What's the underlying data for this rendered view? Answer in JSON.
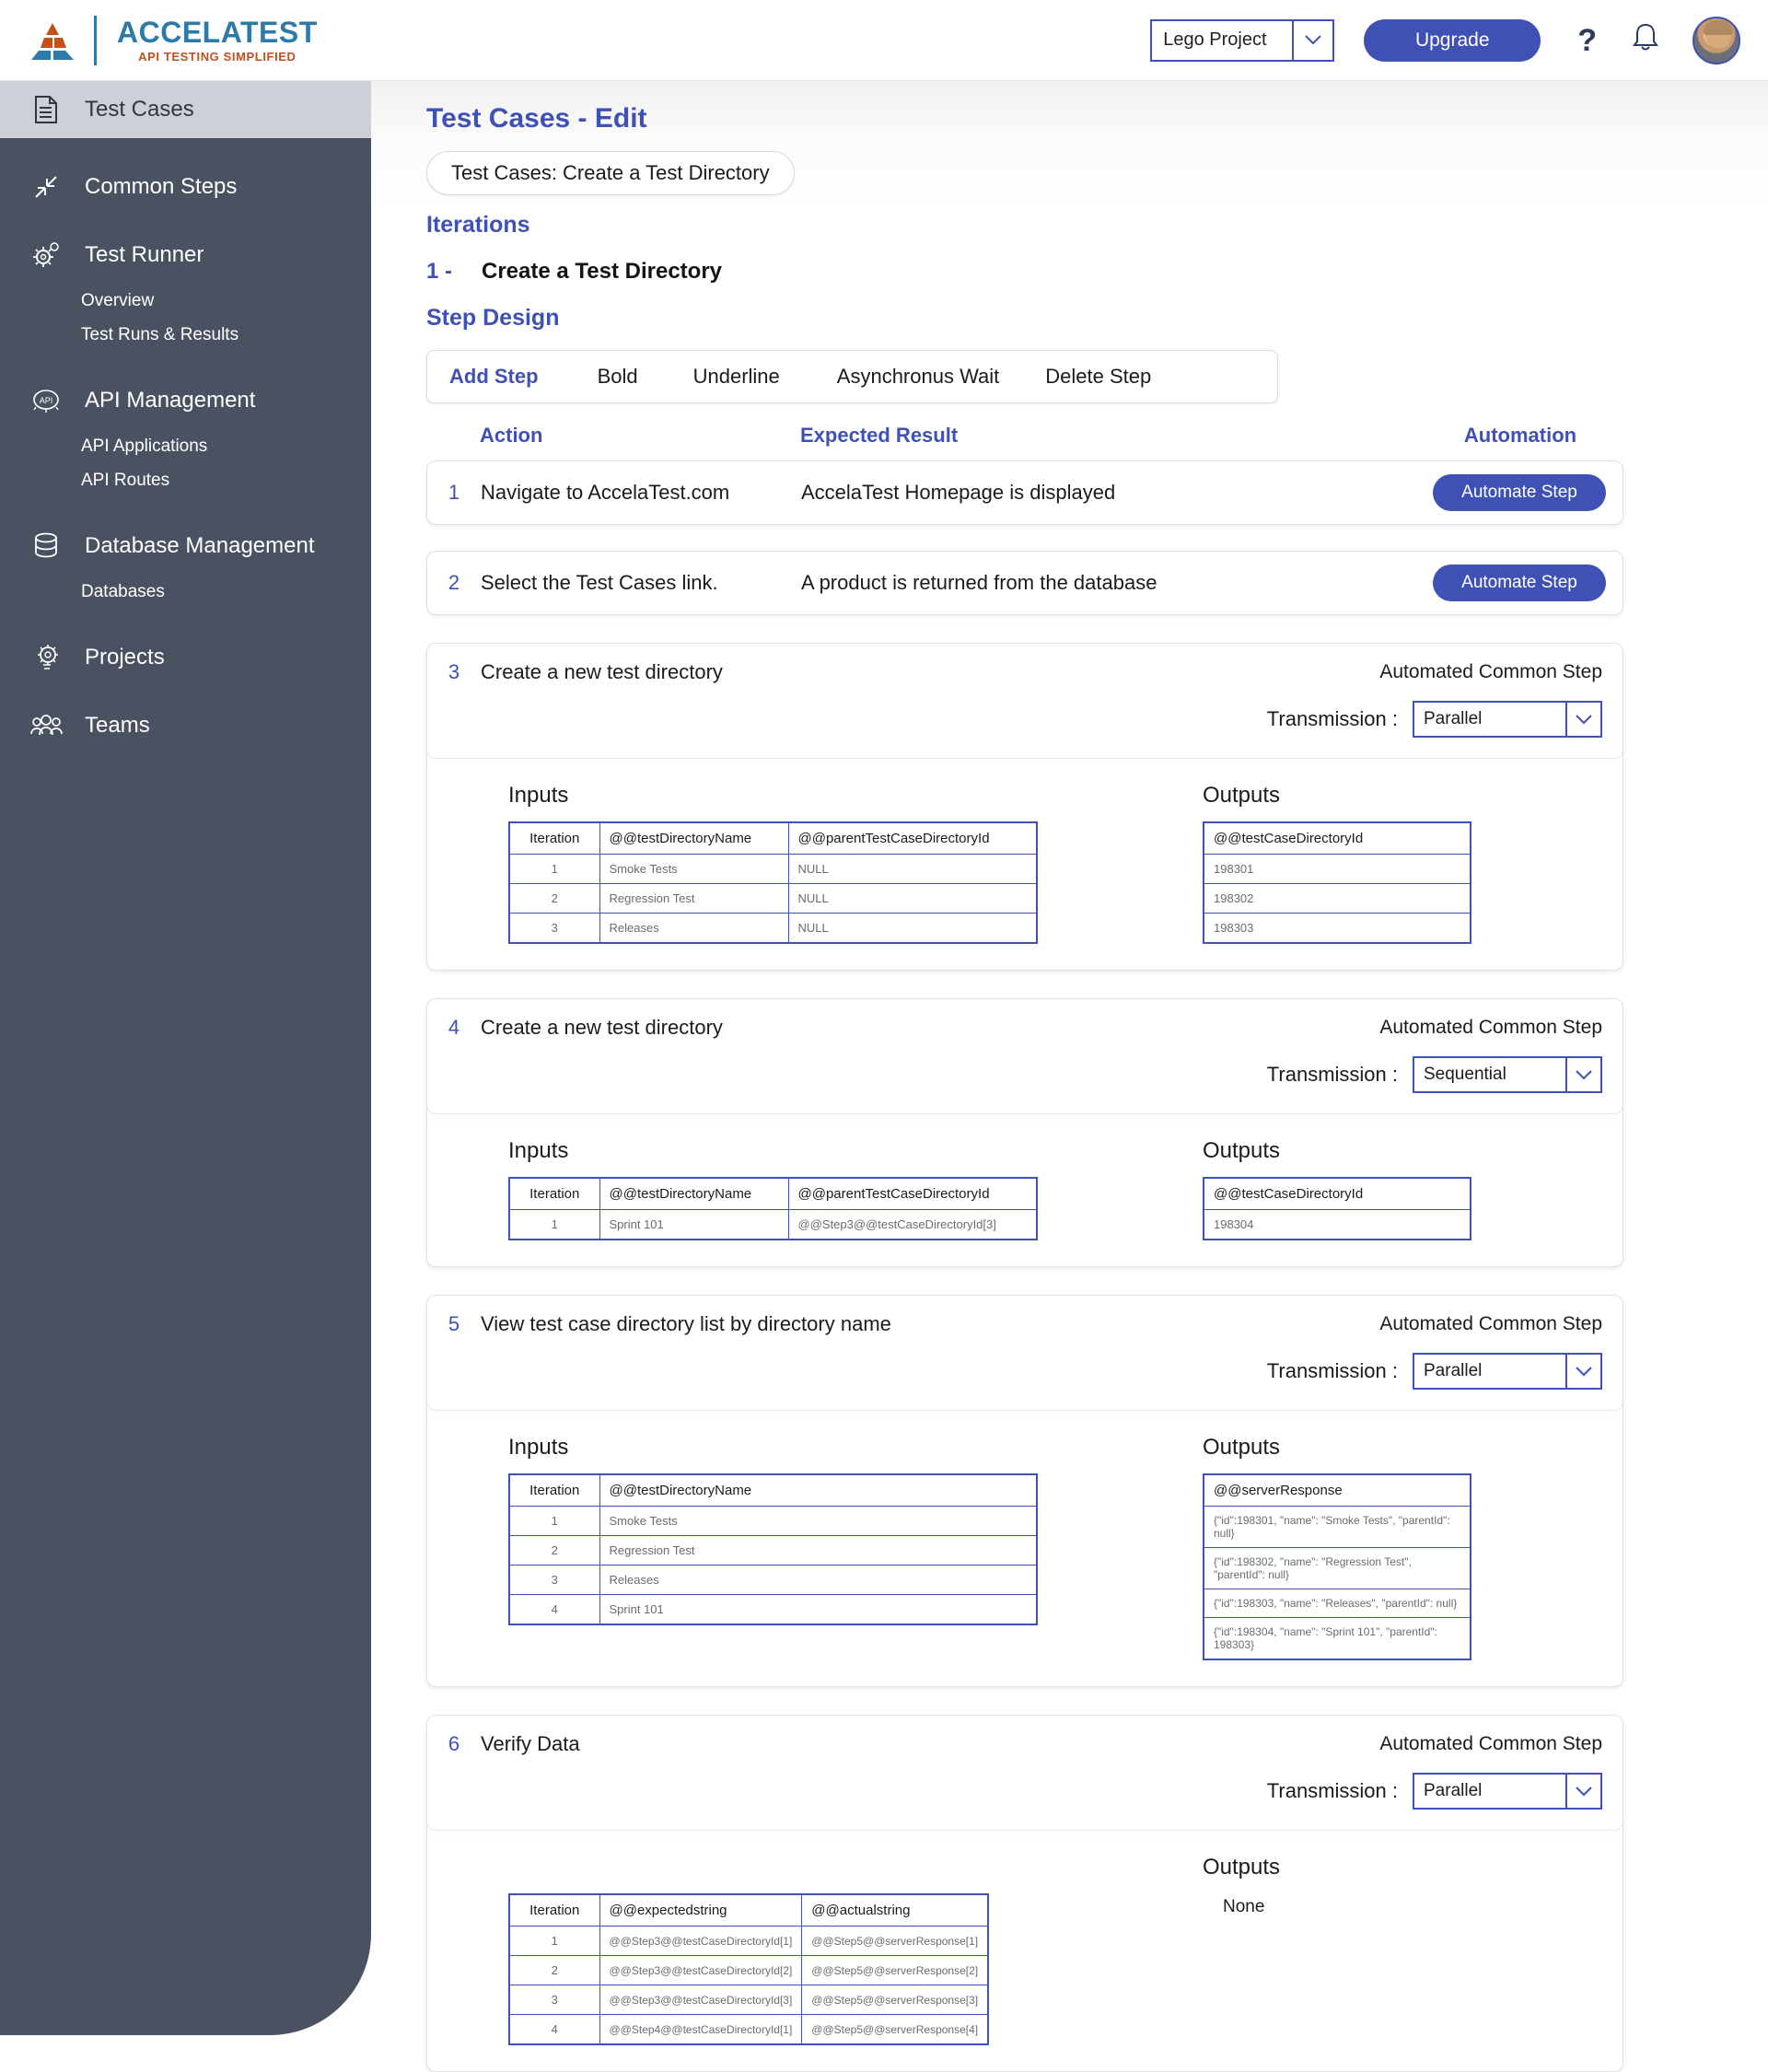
{
  "header": {
    "logo_title_a": "ACCELA",
    "logo_title_b": "TEST",
    "logo_subtitle": "API TESTING SIMPLIFIED",
    "project_select_value": "Lego Project",
    "upgrade_label": "Upgrade",
    "help_label": "?",
    "accent_color": "#3f51b5",
    "logo_blue": "#2e7aa8",
    "logo_orange": "#c24f1c"
  },
  "sidebar": {
    "bg_color": "#4a5261",
    "items": [
      {
        "label": "Test Cases",
        "icon": "document-icon",
        "active": true
      },
      {
        "label": "Common Steps",
        "icon": "arrows-collapse-icon",
        "active": false
      },
      {
        "label": "Test Runner",
        "icon": "gear-icon",
        "active": false
      },
      {
        "label": "API Management",
        "icon": "api-gear-icon",
        "active": false
      },
      {
        "label": "Database Management",
        "icon": "database-icon",
        "active": false
      },
      {
        "label": "Projects",
        "icon": "lightbulb-gear-icon",
        "active": false
      },
      {
        "label": "Teams",
        "icon": "people-icon",
        "active": false
      }
    ],
    "test_runner_sub": [
      "Overview",
      "Test Runs & Results"
    ],
    "api_sub": [
      "API Applications",
      "API Routes"
    ],
    "db_sub": [
      "Databases"
    ]
  },
  "main": {
    "page_title": "Test Cases - Edit",
    "testcase_pill": "Test Cases: Create a Test Directory",
    "iterations_heading": "Iterations",
    "iteration_number": "1 -",
    "iteration_name": "Create a Test Directory",
    "step_design_heading": "Step Design",
    "toolbar": {
      "add_step": "Add Step",
      "bold": "Bold",
      "underline": "Underline",
      "async_wait": "Asynchronus Wait",
      "delete_step": "Delete Step"
    },
    "columns": {
      "action": "Action",
      "expected_result": "Expected Result",
      "automation": "Automation"
    },
    "automate_label": "Automate Step",
    "common_step_badge": "Automated Common Step",
    "transmission_label": "Transmission :",
    "inputs_label": "Inputs",
    "outputs_label": "Outputs",
    "none_label": "None"
  },
  "steps": [
    {
      "number": "1",
      "action": "Navigate to AccelaTest.com",
      "expected": "AccelaTest Homepage is displayed",
      "type": "simple"
    },
    {
      "number": "2",
      "action": "Select the Test Cases link.",
      "expected": "A product is returned from the database",
      "type": "simple"
    },
    {
      "number": "3",
      "action": "Create a new test directory",
      "type": "common",
      "transmission": "Parallel",
      "inputs": {
        "headers": [
          "Iteration",
          "@@testDirectoryName",
          "@@parentTestCaseDirectoryId"
        ],
        "rows": [
          [
            "1",
            "Smoke Tests",
            "NULL"
          ],
          [
            "2",
            "Regression Test",
            "NULL"
          ],
          [
            "3",
            "Releases",
            "NULL"
          ]
        ]
      },
      "outputs": {
        "headers": [
          "@@testCaseDirectoryId"
        ],
        "rows": [
          [
            "198301"
          ],
          [
            "198302"
          ],
          [
            "198303"
          ]
        ]
      }
    },
    {
      "number": "4",
      "action": "Create a new test directory",
      "type": "common",
      "transmission": "Sequential",
      "inputs": {
        "headers": [
          "Iteration",
          "@@testDirectoryName",
          "@@parentTestCaseDirectoryId"
        ],
        "rows": [
          [
            "1",
            "Sprint 101",
            "@@Step3@@testCaseDirectoryId[3]"
          ]
        ]
      },
      "outputs": {
        "headers": [
          "@@testCaseDirectoryId"
        ],
        "rows": [
          [
            "198304"
          ]
        ]
      }
    },
    {
      "number": "5",
      "action": "View test case directory list by directory name",
      "type": "common",
      "transmission": "Parallel",
      "inputs": {
        "headers": [
          "Iteration",
          "@@testDirectoryName"
        ],
        "rows": [
          [
            "1",
            "Smoke Tests"
          ],
          [
            "2",
            "Regression Test"
          ],
          [
            "3",
            "Releases"
          ],
          [
            "4",
            "Sprint 101"
          ]
        ]
      },
      "outputs": {
        "headers": [
          "@@serverResponse"
        ],
        "rows": [
          [
            "{\"id\":198301, \"name\": \"Smoke Tests\", \"parentId\": null}"
          ],
          [
            "{\"id\":198302, \"name\": \"Regression Test\", \"parentId\": null}"
          ],
          [
            "{\"id\":198303, \"name\": \"Releases\", \"parentId\": null}"
          ],
          [
            "{\"id\":198304, \"name\": \"Sprint 101\", \"parentId\": 198303}"
          ]
        ]
      }
    },
    {
      "number": "6",
      "action": "Verify Data",
      "type": "common",
      "transmission": "Parallel",
      "inputs": {
        "headers": [
          "Iteration",
          "@@expectedstring",
          "@@actualstring"
        ],
        "rows": [
          [
            "1",
            "@@Step3@@testCaseDirectoryId[1]",
            "@@Step5@@serverResponse[1]"
          ],
          [
            "2",
            "@@Step3@@testCaseDirectoryId[2]",
            "@@Step5@@serverResponse[2]"
          ],
          [
            "3",
            "@@Step3@@testCaseDirectoryId[3]",
            "@@Step5@@serverResponse[3]"
          ],
          [
            "4",
            "@@Step4@@testCaseDirectoryId[1]",
            "@@Step5@@serverResponse[4]"
          ]
        ]
      },
      "outputs": {
        "headers": [],
        "rows": [],
        "none": true
      }
    }
  ]
}
